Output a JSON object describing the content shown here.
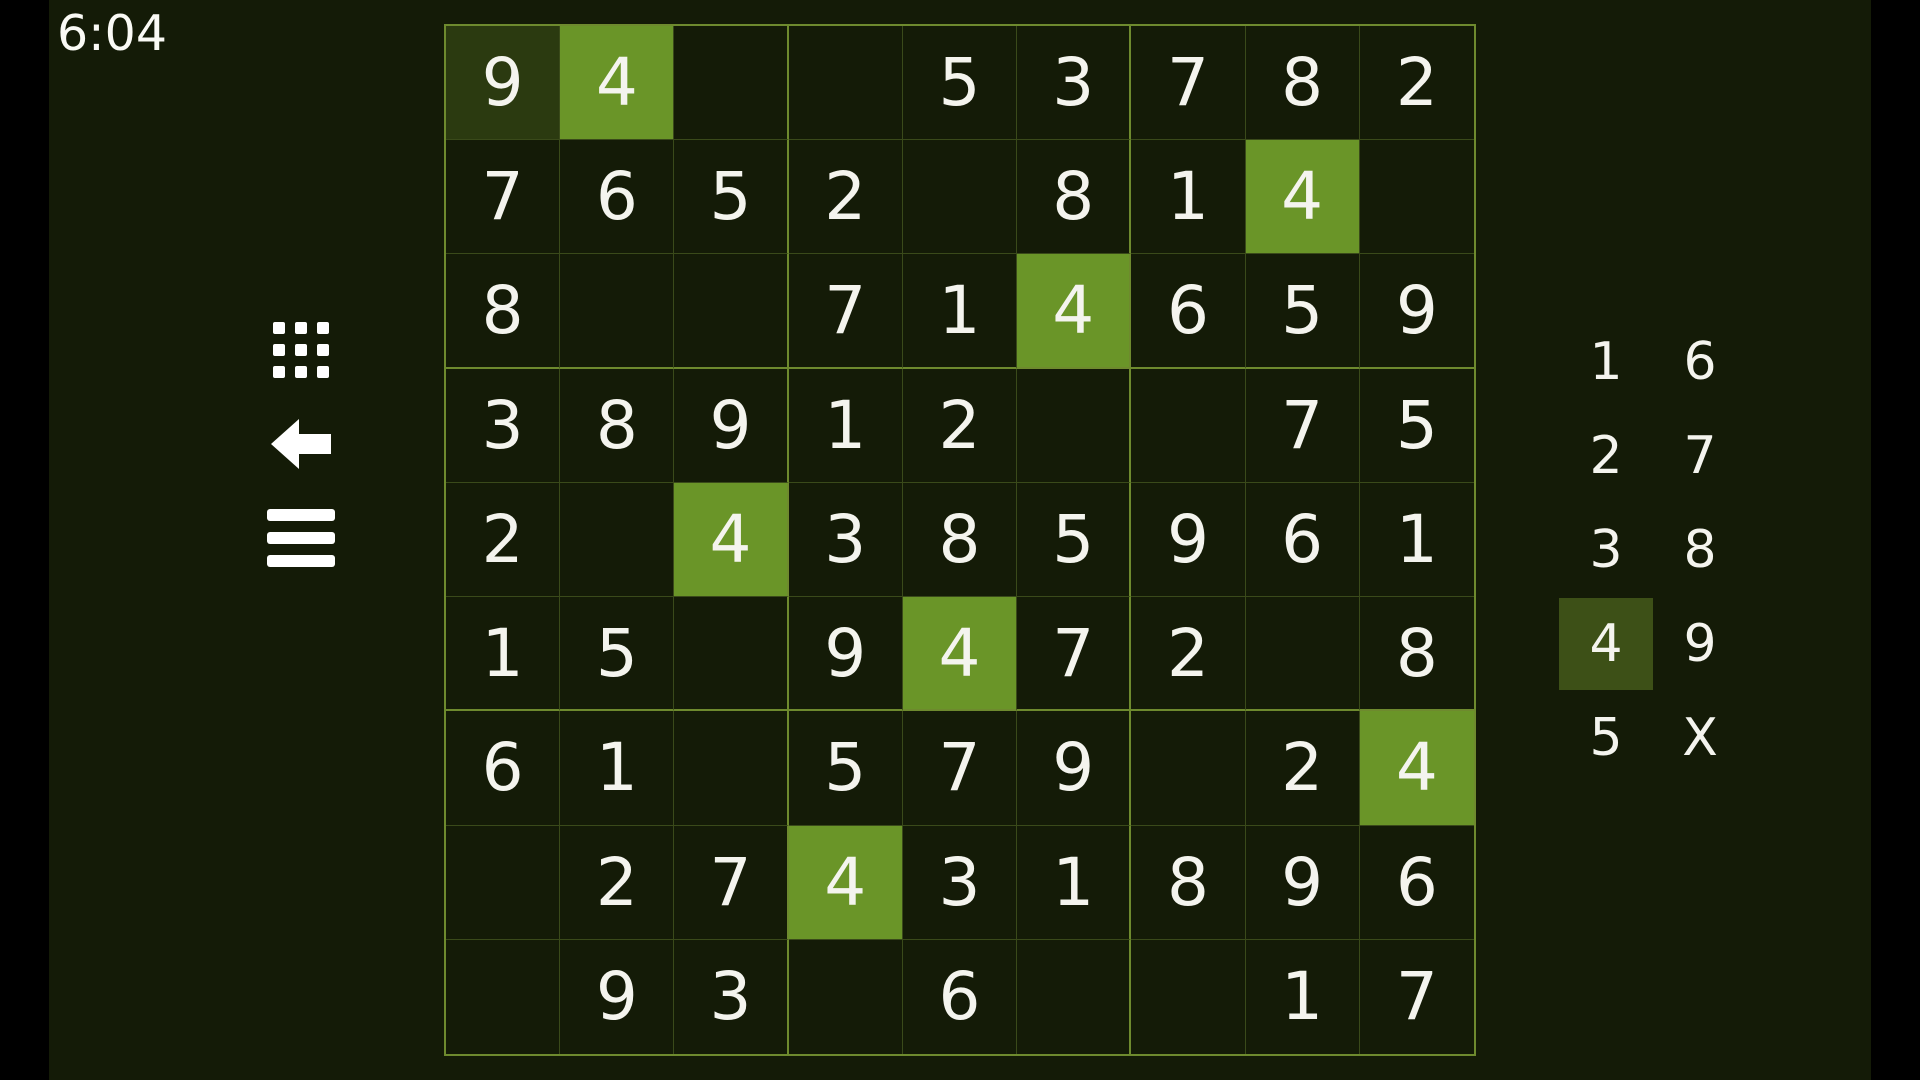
{
  "timer": "6:04",
  "tools": [
    {
      "name": "grid-icon"
    },
    {
      "name": "undo-arrow-icon"
    },
    {
      "name": "menu-icon"
    }
  ],
  "highlight_digit": "4",
  "board": [
    [
      "9",
      "4",
      "",
      "",
      "5",
      "3",
      "7",
      "8",
      "2"
    ],
    [
      "7",
      "6",
      "5",
      "2",
      "",
      "8",
      "1",
      "4",
      ""
    ],
    [
      "8",
      "",
      "",
      "7",
      "1",
      "4",
      "6",
      "5",
      "9"
    ],
    [
      "3",
      "8",
      "9",
      "1",
      "2",
      "",
      "",
      "7",
      "5"
    ],
    [
      "2",
      "",
      "4",
      "3",
      "8",
      "5",
      "9",
      "6",
      "1"
    ],
    [
      "1",
      "5",
      "",
      "9",
      "4",
      "7",
      "2",
      "",
      "8"
    ],
    [
      "6",
      "1",
      "",
      "5",
      "7",
      "9",
      "",
      "2",
      "4"
    ],
    [
      "",
      "2",
      "7",
      "4",
      "3",
      "1",
      "8",
      "9",
      "6"
    ],
    [
      "",
      "9",
      "3",
      "",
      "6",
      "",
      "",
      "1",
      "7"
    ]
  ],
  "selected_cell": [
    0,
    0
  ],
  "numpad": {
    "keys": [
      "1",
      "2",
      "3",
      "4",
      "5",
      "6",
      "7",
      "8",
      "9",
      "X"
    ],
    "active": "4"
  },
  "colors": {
    "background": "#141b07",
    "highlight": "#6a9528",
    "selected": "#2b3a10",
    "grid_line": "#6e8a2e",
    "numpad_active": "#3d5017"
  }
}
